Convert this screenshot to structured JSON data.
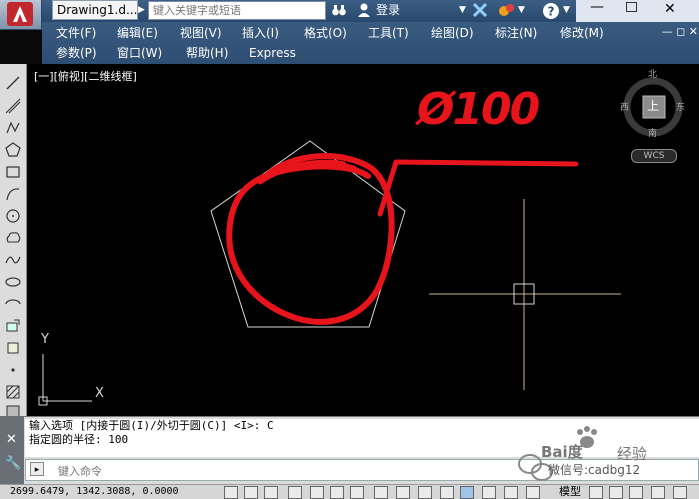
{
  "titlebar": {
    "doc_title": "Drawing1.d...",
    "search_placeholder": "键入关键字或短语",
    "login_label": "登录"
  },
  "menus": {
    "row1": [
      "文件(F)",
      "编辑(E)",
      "视图(V)",
      "插入(I)",
      "格式(O)",
      "工具(T)",
      "绘图(D)",
      "标注(N)",
      "修改(M)"
    ],
    "row2": [
      "参数(P)",
      "窗口(W)",
      "帮助(H)",
      "Express"
    ]
  },
  "viewport": {
    "label": "[一][俯视][二维线框]",
    "compass": {
      "north": "北",
      "south": "南",
      "east": "东",
      "west": "西",
      "top": "上"
    },
    "wcs": "WCS",
    "ucs_x": "X",
    "ucs_y": "Y",
    "annotation": "Ø100"
  },
  "command": {
    "history": [
      "输入选项 [内接于圆(I)/外切于圆(C)] <I>: C",
      "指定圆的半径: 100"
    ],
    "prompt_placeholder": "键入命令"
  },
  "status": {
    "coords": "2699.6479, 1342.3088, 0.0000",
    "model": "模型"
  },
  "watermark": {
    "baidu": "Bai度",
    "jingyan": "经验",
    "wechat": "微信号:cadbg12"
  },
  "colors": {
    "canvas": "#000000",
    "markup_red": "#e8141b",
    "geometry_white": "#d8d8d8",
    "crosshair": "#c8b48c"
  }
}
